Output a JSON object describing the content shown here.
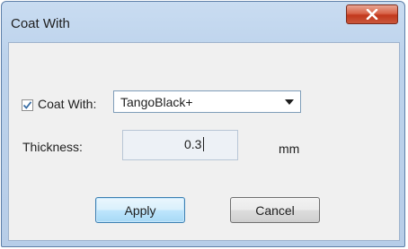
{
  "window": {
    "title": "Coat With",
    "close_label": "X"
  },
  "coat_with": {
    "checked": true,
    "label": "Coat With:",
    "selected_material": "TangoBlack+"
  },
  "thickness": {
    "label": "Thickness:",
    "value": "0.3",
    "unit": "mm"
  },
  "buttons": {
    "apply": "Apply",
    "cancel": "Cancel"
  },
  "colors": {
    "close_button": "#c9573c",
    "apply_button_border": "#3c7fb1",
    "window_frame": "#bdd3ec"
  }
}
